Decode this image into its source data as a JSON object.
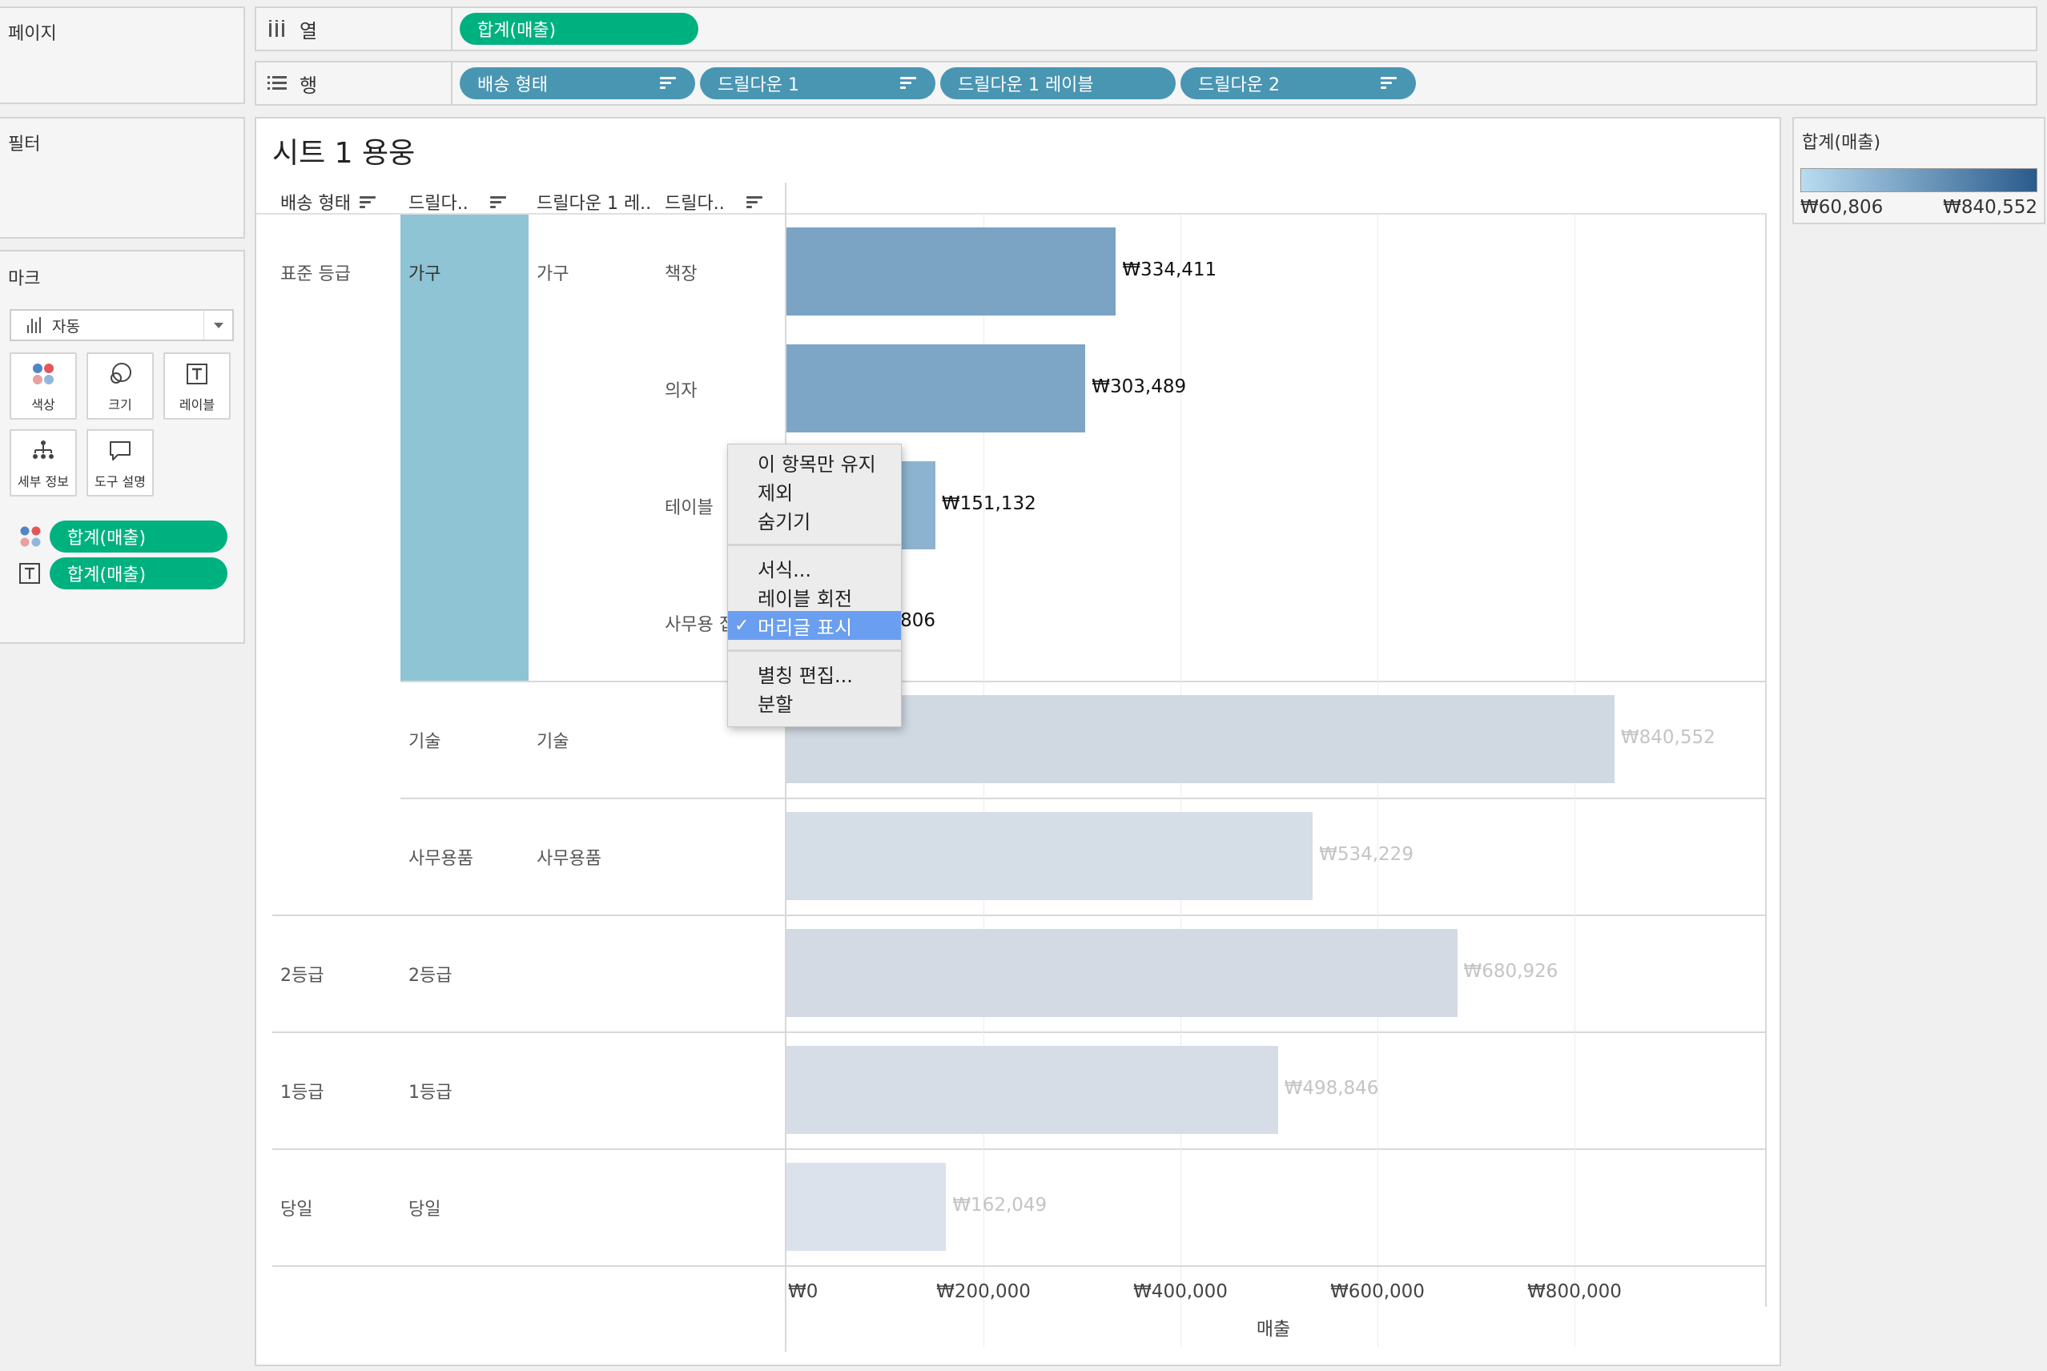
{
  "sidebar": {
    "pages_title": "페이지",
    "filters_title": "필터",
    "marks_title": "마크",
    "mark_type": "자동",
    "cards": {
      "color": "색상",
      "size": "크기",
      "label": "레이블",
      "detail": "세부 정보",
      "tooltip": "도구 설명"
    },
    "mark_pills": [
      {
        "icon": "color-dots-icon",
        "label": "합계(매출)"
      },
      {
        "icon": "text-t-icon",
        "label": "합계(매출)"
      }
    ]
  },
  "shelves": {
    "columns_label": "열",
    "rows_label": "행",
    "column_pills": [
      "합계(매출)"
    ],
    "row_pills": [
      "배송 형태",
      "드릴다운 1",
      "드릴다운 1 레이블",
      "드릴다운 2"
    ]
  },
  "sheet": {
    "title": "시트 1 용웅",
    "headers": [
      "배송 형태",
      "드릴다..",
      "드릴다운 1 레..",
      "드릴다.."
    ],
    "rows": [
      {
        "ship": "표준 등급",
        "d1": "가구",
        "d1label": "가구",
        "d2": "책장",
        "value_label": "₩334,411"
      },
      {
        "ship": "",
        "d1": "",
        "d1label": "",
        "d2": "의자",
        "value_label": "₩303,489"
      },
      {
        "ship": "",
        "d1": "",
        "d1label": "",
        "d2": "테이블",
        "value_label": "₩151,132"
      },
      {
        "ship": "",
        "d1": "",
        "d1label": "",
        "d2": "사무용 집기",
        "value_label": "₩60,806"
      },
      {
        "ship": "",
        "d1": "기술",
        "d1label": "기술",
        "d2": "",
        "value_label": "₩840,552"
      },
      {
        "ship": "",
        "d1": "사무용품",
        "d1label": "사무용품",
        "d2": "",
        "value_label": "₩534,229"
      },
      {
        "ship": "2등급",
        "d1": "2등급",
        "d1label": "",
        "d2": "",
        "value_label": "₩680,926"
      },
      {
        "ship": "1등급",
        "d1": "1등급",
        "d1label": "",
        "d2": "",
        "value_label": "₩498,846"
      },
      {
        "ship": "당일",
        "d1": "당일",
        "d1label": "",
        "d2": "",
        "value_label": "₩162,049"
      }
    ],
    "axis_ticks": [
      "₩0",
      "₩200,000",
      "₩400,000",
      "₩600,000",
      "₩800,000"
    ],
    "axis_title": "매출"
  },
  "context_menu": {
    "items": [
      "이 항목만 유지",
      "제외",
      "숨기기",
      "서식...",
      "레이블 회전",
      "머리글 표시",
      "별칭 편집...",
      "분할"
    ],
    "selected": "머리글 표시",
    "check_glyph": "✓"
  },
  "legend": {
    "title": "합계(매출)",
    "min_label": "₩60,806",
    "max_label": "₩840,552",
    "color_low": "#b9dcf0",
    "color_high": "#2a5b8c"
  },
  "chart_data": {
    "type": "bar",
    "categories": [
      "책장",
      "의자",
      "테이블",
      "사무용 집기",
      "기술",
      "사무용품",
      "2등급",
      "1등급",
      "당일"
    ],
    "values": [
      334411,
      303489,
      151132,
      60806,
      840552,
      534229,
      680926,
      498846,
      162049
    ],
    "highlighted": [
      true,
      true,
      true,
      true,
      false,
      false,
      false,
      false,
      false
    ],
    "xlabel": "매출",
    "xlim": [
      0,
      1000000
    ],
    "xticks": [
      0,
      200000,
      400000,
      600000,
      800000
    ],
    "colors": {
      "bar_low": "#b9dcf0",
      "bar_high": "#2a5b8c",
      "dimmed": "#d2d9e2"
    }
  }
}
